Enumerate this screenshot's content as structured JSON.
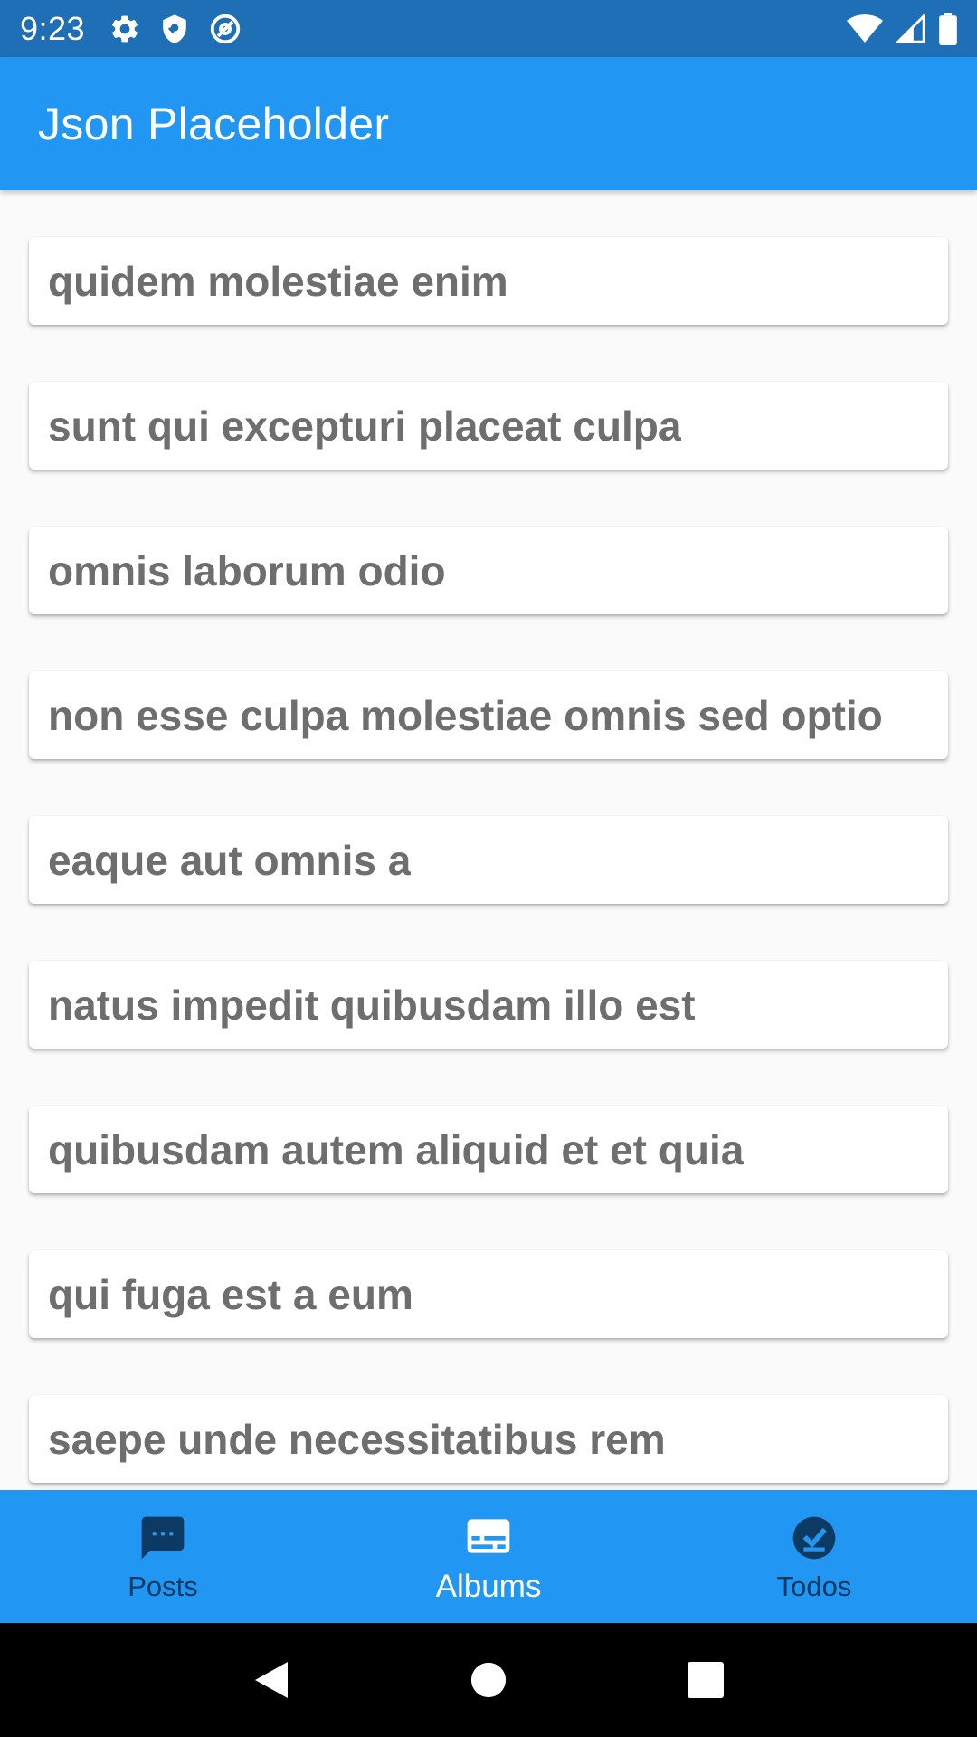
{
  "status_bar": {
    "time": "9:23",
    "left_icons": [
      "gear-icon",
      "shield-icon",
      "at-sign-icon"
    ],
    "right_icons": [
      "wifi-icon",
      "signal-icon",
      "battery-icon"
    ]
  },
  "app_bar": {
    "title": "Json Placeholder"
  },
  "albums": [
    {
      "title": "quidem molestiae enim"
    },
    {
      "title": "sunt qui excepturi placeat culpa"
    },
    {
      "title": "omnis laborum odio"
    },
    {
      "title": "non esse culpa molestiae omnis sed optio"
    },
    {
      "title": "eaque aut omnis a"
    },
    {
      "title": "natus impedit quibusdam illo est"
    },
    {
      "title": "quibusdam autem aliquid et et quia"
    },
    {
      "title": "qui fuga est a eum"
    },
    {
      "title": "saepe unde necessitatibus rem"
    }
  ],
  "bottom_nav": {
    "items": [
      {
        "label": "Posts",
        "icon": "chat-bubble-icon",
        "active": false
      },
      {
        "label": "Albums",
        "icon": "subtitles-icon",
        "active": true
      },
      {
        "label": "Todos",
        "icon": "check-circle-icon",
        "active": false
      }
    ]
  },
  "system_nav": {
    "buttons": [
      "back-icon",
      "home-icon",
      "recents-icon"
    ]
  },
  "colors": {
    "status_bar": "#1E6FB5",
    "primary": "#2196F3",
    "inactive_nav": "#0D3A63",
    "card_text": "#6E6E6E",
    "background": "#FAFAFA"
  }
}
